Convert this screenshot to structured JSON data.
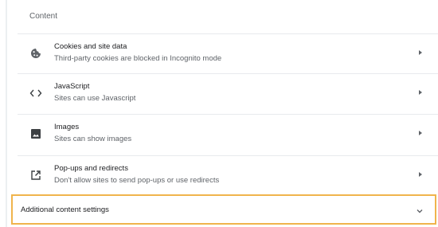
{
  "section": {
    "title": "Content"
  },
  "rows": [
    {
      "label": "Cookies and site data",
      "sublabel": "Third-party cookies are blocked in Incognito mode",
      "icon": "cookie-icon"
    },
    {
      "label": "JavaScript",
      "sublabel": "Sites can use Javascript",
      "icon": "code-icon"
    },
    {
      "label": "Images",
      "sublabel": "Sites can show images",
      "icon": "image-icon"
    },
    {
      "label": "Pop-ups and redirects",
      "sublabel": "Don't allow sites to send pop-ups or use redirects",
      "icon": "open-in-new-icon"
    }
  ],
  "additional": {
    "label": "Additional content settings",
    "icon": "chevron-down-icon"
  },
  "colors": {
    "highlight": "#f0b44c",
    "icon": "#5f6368",
    "text": "#202124",
    "secondary_text": "#5f6368"
  }
}
